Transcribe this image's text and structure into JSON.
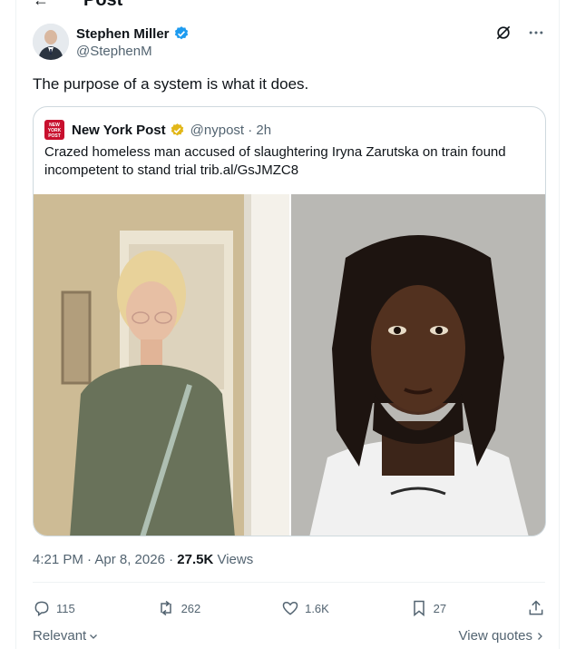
{
  "header": {
    "back_icon": "arrow-left-icon",
    "title": "Post"
  },
  "author": {
    "name": "Stephen Miller",
    "handle": "@StephenM",
    "verified_color": "#1d9bf0"
  },
  "post": {
    "text": "The purpose of a system is what it does."
  },
  "quote": {
    "logo_text": "NEW YORK POST",
    "name": "New York Post",
    "verified_color": "#e2b719",
    "handle_time": "@nypost · 2h",
    "text": "Crazed homeless man accused of slaughtering Iryna Zarutska on train found incompetent to stand trial trib.al/GsJMZC8"
  },
  "meta": {
    "timestamp": "4:21 PM · Apr 8, 2026 · ",
    "views_count": "27.5K",
    "views_label": " Views"
  },
  "actions": {
    "replies": "115",
    "reposts": "262",
    "likes": "1.6K",
    "bookmarks": "27"
  },
  "footer": {
    "relevant": "Relevant",
    "view_quotes": "View quotes"
  },
  "colors": {
    "accent": "#1d9bf0",
    "secondary_text": "#536471",
    "border": "#cfd9de"
  }
}
